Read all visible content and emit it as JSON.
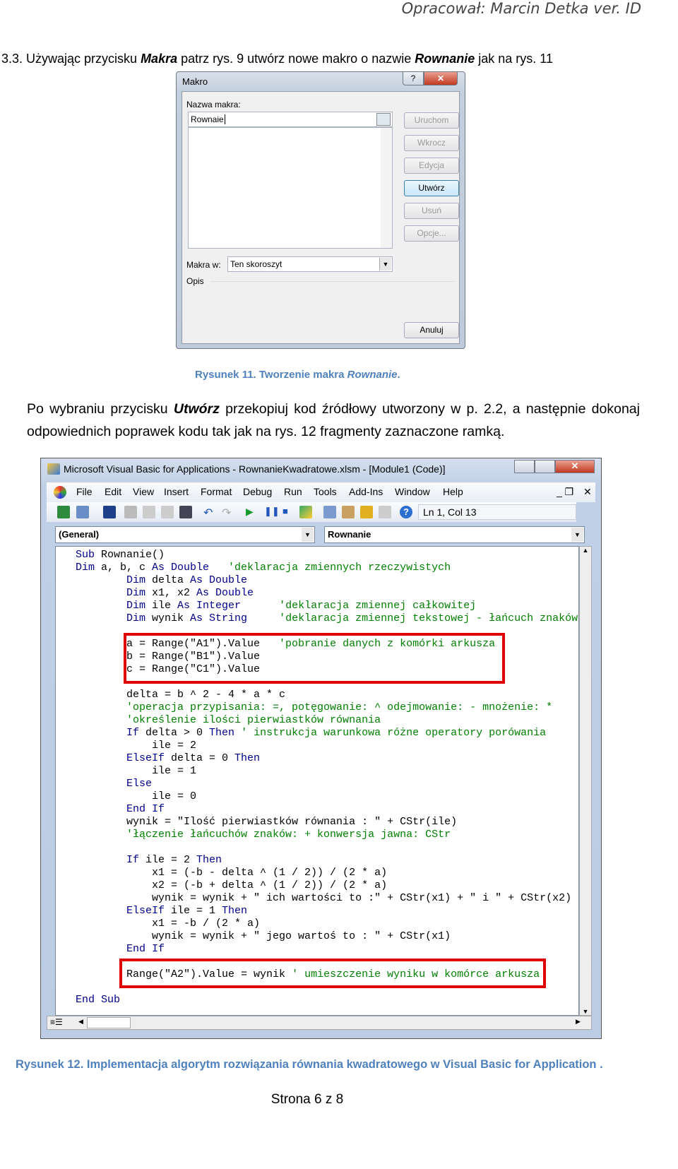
{
  "header": {
    "author": "Opracował: Marcin Detka ver. ID"
  },
  "intro": {
    "prefix": "3.3.  Używając przycisku ",
    "bold1": "Makra",
    "mid": " patrz rys. 9 utwórz nowe makro o nazwie ",
    "bold2": "Rownanie",
    "suffix": " jak na rys. 11"
  },
  "macro_dialog": {
    "title": "Makro",
    "help": "?",
    "close": "✕",
    "name_label": "Nazwa makra:",
    "name_value": "Rownaie",
    "buttons": [
      "Uruchom",
      "Wkrocz",
      "Edycja",
      "Utwórz",
      "Usuń",
      "Opcje..."
    ],
    "active_button": "Utwórz",
    "macros_in_label": "Makra w:",
    "macros_in_value": "Ten skoroszyt",
    "description_label": "Opis",
    "cancel": "Anuluj"
  },
  "caption1": {
    "text": "Rysunek 11. Tworzenie makra ",
    "italic": "Rownanie",
    "end": "."
  },
  "paragraph": {
    "prefix": "Po wybraniu przycisku ",
    "bold": "Utwórz",
    "suffix": " przekopiuj kod źródłowy utworzony w p. 2.2, a następnie dokonaj odpowiednich poprawek kodu tak jak na rys. 12 fragmenty zaznaczone ramką."
  },
  "vba_window": {
    "title": "Microsoft Visual Basic for Applications - RownanieKwadratowe.xlsm - [Module1 (Code)]",
    "menu": [
      "File",
      "Edit",
      "View",
      "Insert",
      "Format",
      "Debug",
      "Run",
      "Tools",
      "Add-Ins",
      "Window",
      "Help"
    ],
    "position": "Ln 1, Col 13",
    "object_combo": "(General)",
    "procedure_combo": "Rownanie",
    "colors": {
      "keyword": "#00008b",
      "comment": "#008000",
      "highlight_box": "#e00000"
    },
    "code": [
      [
        [
          "k",
          "Sub "
        ],
        [
          "n",
          "Rownanie()"
        ]
      ],
      [
        [
          "k",
          "Dim "
        ],
        [
          "n",
          "a, b, c "
        ],
        [
          "k",
          "As Double"
        ],
        [
          "c",
          "   'deklaracja zmiennych rzeczywistych"
        ]
      ],
      [
        [
          "n",
          "        "
        ],
        [
          "k",
          "Dim "
        ],
        [
          "n",
          "delta "
        ],
        [
          "k",
          "As Double"
        ]
      ],
      [
        [
          "n",
          "        "
        ],
        [
          "k",
          "Dim "
        ],
        [
          "n",
          "x1, x2 "
        ],
        [
          "k",
          "As Double"
        ]
      ],
      [
        [
          "n",
          "        "
        ],
        [
          "k",
          "Dim "
        ],
        [
          "n",
          "ile "
        ],
        [
          "k",
          "As Integer"
        ],
        [
          "c",
          "      'deklaracja zmiennej całkowitej"
        ]
      ],
      [
        [
          "n",
          "        "
        ],
        [
          "k",
          "Dim "
        ],
        [
          "n",
          "wynik "
        ],
        [
          "k",
          "As String"
        ],
        [
          "c",
          "     'deklaracja zmiennej tekstowej - łańcuch znaków"
        ]
      ],
      [],
      [
        [
          "n",
          "        a = Range(\"A1\").Value"
        ],
        [
          "c",
          "   'pobranie danych z komórki arkusza"
        ]
      ],
      [
        [
          "n",
          "        b = Range(\"B1\").Value"
        ]
      ],
      [
        [
          "n",
          "        c = Range(\"C1\").Value"
        ]
      ],
      [],
      [
        [
          "n",
          "        delta = b ^ 2 - 4 * a * c"
        ]
      ],
      [
        [
          "c",
          "        'operacja przypisania: =, potęgowanie: ^ odejmowanie: - mnożenie: *"
        ]
      ],
      [
        [
          "c",
          "        'określenie ilości pierwiastków równania"
        ]
      ],
      [
        [
          "n",
          "        "
        ],
        [
          "k",
          "If "
        ],
        [
          "n",
          "delta > 0 "
        ],
        [
          "k",
          "Then"
        ],
        [
          "c",
          " ' instrukcja warunkowa różne operatory porówania"
        ]
      ],
      [
        [
          "n",
          "            ile = 2"
        ]
      ],
      [
        [
          "n",
          "        "
        ],
        [
          "k",
          "ElseIf "
        ],
        [
          "n",
          "delta = 0 "
        ],
        [
          "k",
          "Then"
        ]
      ],
      [
        [
          "n",
          "            ile = 1"
        ]
      ],
      [
        [
          "n",
          "        "
        ],
        [
          "k",
          "Else"
        ]
      ],
      [
        [
          "n",
          "            ile = 0"
        ]
      ],
      [
        [
          "n",
          "        "
        ],
        [
          "k",
          "End If"
        ]
      ],
      [
        [
          "n",
          "        wynik = \"Ilość pierwiastków równania : \" + CStr(ile)"
        ]
      ],
      [
        [
          "c",
          "        'łączenie łańcuchów znaków: + konwersja jawna: CStr"
        ]
      ],
      [],
      [
        [
          "n",
          "        "
        ],
        [
          "k",
          "If "
        ],
        [
          "n",
          "ile = 2 "
        ],
        [
          "k",
          "Then"
        ]
      ],
      [
        [
          "n",
          "            x1 = (-b - delta ^ (1 / 2)) / (2 * a)"
        ]
      ],
      [
        [
          "n",
          "            x2 = (-b + delta ^ (1 / 2)) / (2 * a)"
        ]
      ],
      [
        [
          "n",
          "            wynik = wynik + \" ich wartości to :\" + CStr(x1) + \" i \" + CStr(x2)"
        ]
      ],
      [
        [
          "n",
          "        "
        ],
        [
          "k",
          "ElseIf "
        ],
        [
          "n",
          "ile = 1 "
        ],
        [
          "k",
          "Then"
        ]
      ],
      [
        [
          "n",
          "            x1 = -b / (2 * a)"
        ]
      ],
      [
        [
          "n",
          "            wynik = wynik + \" jego wartoś to : \" + CStr(x1)"
        ]
      ],
      [
        [
          "n",
          "        "
        ],
        [
          "k",
          "End If"
        ]
      ],
      [],
      [
        [
          "n",
          "        Range(\"A2\").Value = wynik"
        ],
        [
          "c",
          " ' umieszczenie wyniku w komórce arkusza"
        ]
      ],
      [],
      [
        [
          "k",
          "End Sub"
        ]
      ]
    ]
  },
  "caption2": {
    "text": "Rysunek 12. Implementacja algorytm rozwiązania równania kwadratowego w Visual Basic for Application ."
  },
  "footer": {
    "page": "Strona 6 z 8"
  }
}
